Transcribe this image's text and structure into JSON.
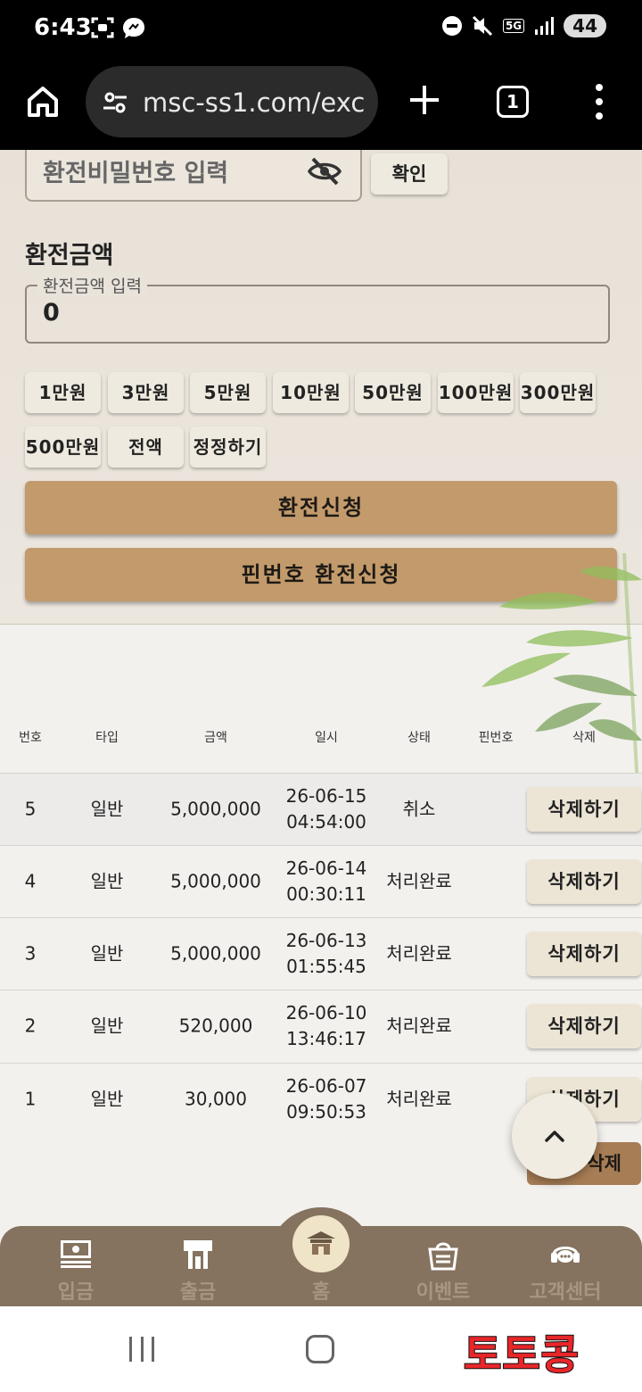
{
  "statusbar": {
    "time": "6:43",
    "battery": "44",
    "network": "5G"
  },
  "browser": {
    "url": "msc-ss1.com/exc",
    "tab_count": "1"
  },
  "form": {
    "password_placeholder": "환전비밀번호 입력",
    "confirm_label": "확인",
    "amount_title": "환전금액",
    "amount_legend": "환전금액 입력",
    "amount_value": "0",
    "quick_amounts": [
      "1만원",
      "3만원",
      "5만원",
      "10만원",
      "50만원",
      "100만원",
      "300만원",
      "500만원",
      "전액",
      "정정하기"
    ],
    "submit_label": "환전신청",
    "pin_submit_label": "핀번호 환전신청"
  },
  "table": {
    "headers": [
      "번호",
      "타입",
      "금액",
      "일시",
      "상태",
      "핀번호",
      "삭제"
    ],
    "rows": [
      {
        "no": "5",
        "type": "일반",
        "amount": "5,000,000",
        "date": "26-06-15",
        "time": "04:54:00",
        "status": "취소",
        "pin": "",
        "action": "삭제하기"
      },
      {
        "no": "4",
        "type": "일반",
        "amount": "5,000,000",
        "date": "26-06-14",
        "time": "00:30:11",
        "status": "처리완료",
        "pin": "",
        "action": "삭제하기"
      },
      {
        "no": "3",
        "type": "일반",
        "amount": "5,000,000",
        "date": "26-06-13",
        "time": "01:55:45",
        "status": "처리완료",
        "pin": "",
        "action": "삭제하기"
      },
      {
        "no": "2",
        "type": "일반",
        "amount": "520,000",
        "date": "26-06-10",
        "time": "13:46:17",
        "status": "처리완료",
        "pin": "",
        "action": "삭제하기"
      },
      {
        "no": "1",
        "type": "일반",
        "amount": "30,000",
        "date": "26-06-07",
        "time": "09:50:53",
        "status": "처리완료",
        "pin": "",
        "action": "삭제하기"
      }
    ],
    "bulk_delete_label": "삭제"
  },
  "bottom_nav": {
    "items": [
      {
        "label": "입금",
        "icon": "deposit-icon"
      },
      {
        "label": "출금",
        "icon": "withdraw-icon"
      },
      {
        "label": "홈",
        "icon": "home-icon"
      },
      {
        "label": "이벤트",
        "icon": "event-icon"
      },
      {
        "label": "고객센터",
        "icon": "support-icon"
      }
    ]
  },
  "watermark": "토토콩",
  "colors": {
    "accent_button": "#c39a6b",
    "nav_background": "#85735f",
    "panel_background": "#e8e1d7"
  }
}
